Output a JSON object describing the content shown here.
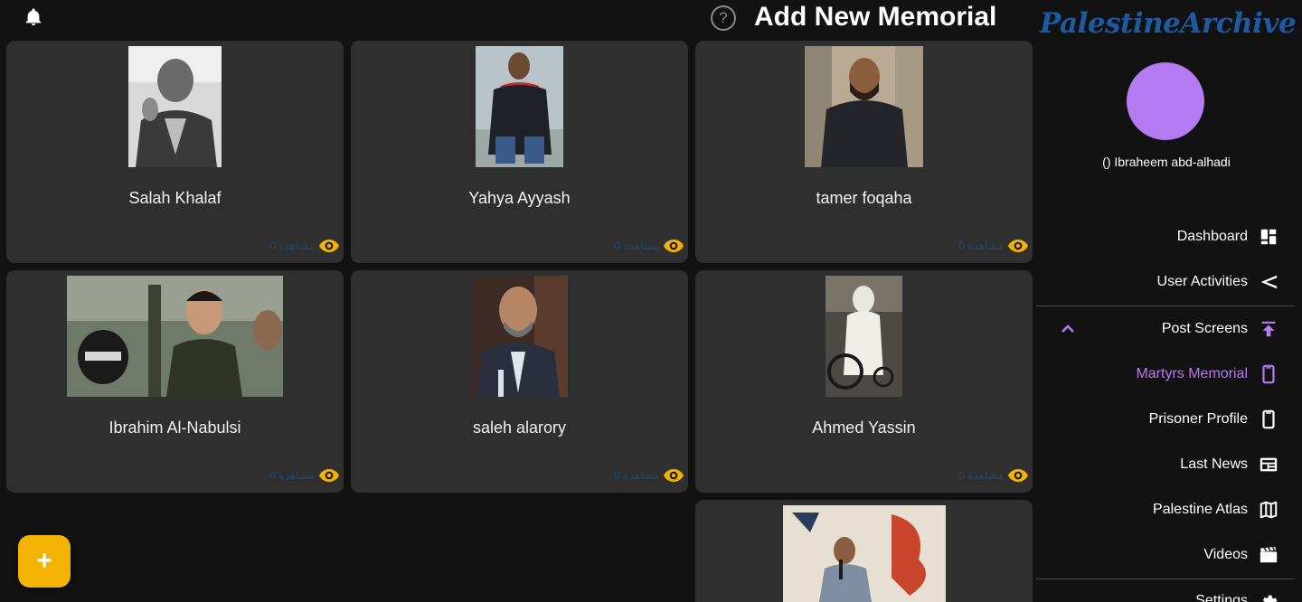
{
  "header": {
    "title": "Add New Memorial"
  },
  "memorials": [
    {
      "name": "Salah Khalaf",
      "views": "0 مشاهدة"
    },
    {
      "name": "Yahya Ayyash",
      "views": "0 مشاهدة"
    },
    {
      "name": "tamer foqaha",
      "views": "0 مشاهدة"
    },
    {
      "name": "Ibrahim Al-Nabulsi",
      "views": "0 مشاهدة"
    },
    {
      "name": "saleh alarory",
      "views": "0 مشاهدة"
    },
    {
      "name": "Ahmed Yassin",
      "views": "0 مشاهدة"
    }
  ],
  "fab": {
    "label": "+"
  },
  "sidebar": {
    "logo": "PalestineArchive",
    "user_name": "() Ibraheem abd-alhadi",
    "items": [
      {
        "label": "Dashboard",
        "icon": "dashboard-icon"
      },
      {
        "label": "User Activities",
        "icon": "share-icon"
      },
      {
        "label": "Post Screens",
        "icon": "upload-icon"
      },
      {
        "label": "Martyrs Memorial",
        "icon": "phone-icon"
      },
      {
        "label": "Prisoner Profile",
        "icon": "phone-icon"
      },
      {
        "label": "Last News",
        "icon": "newspaper-icon"
      },
      {
        "label": "Palestine Atlas",
        "icon": "map-icon"
      },
      {
        "label": "Videos",
        "icon": "video-icon"
      },
      {
        "label": "Settings",
        "icon": "gear-icon"
      }
    ]
  },
  "colors": {
    "background": "#121212",
    "card": "#2f2f2f",
    "accent_yellow": "#f5b301",
    "accent_purple": "#b57bf2",
    "logo_blue": "#1e5aa0"
  }
}
